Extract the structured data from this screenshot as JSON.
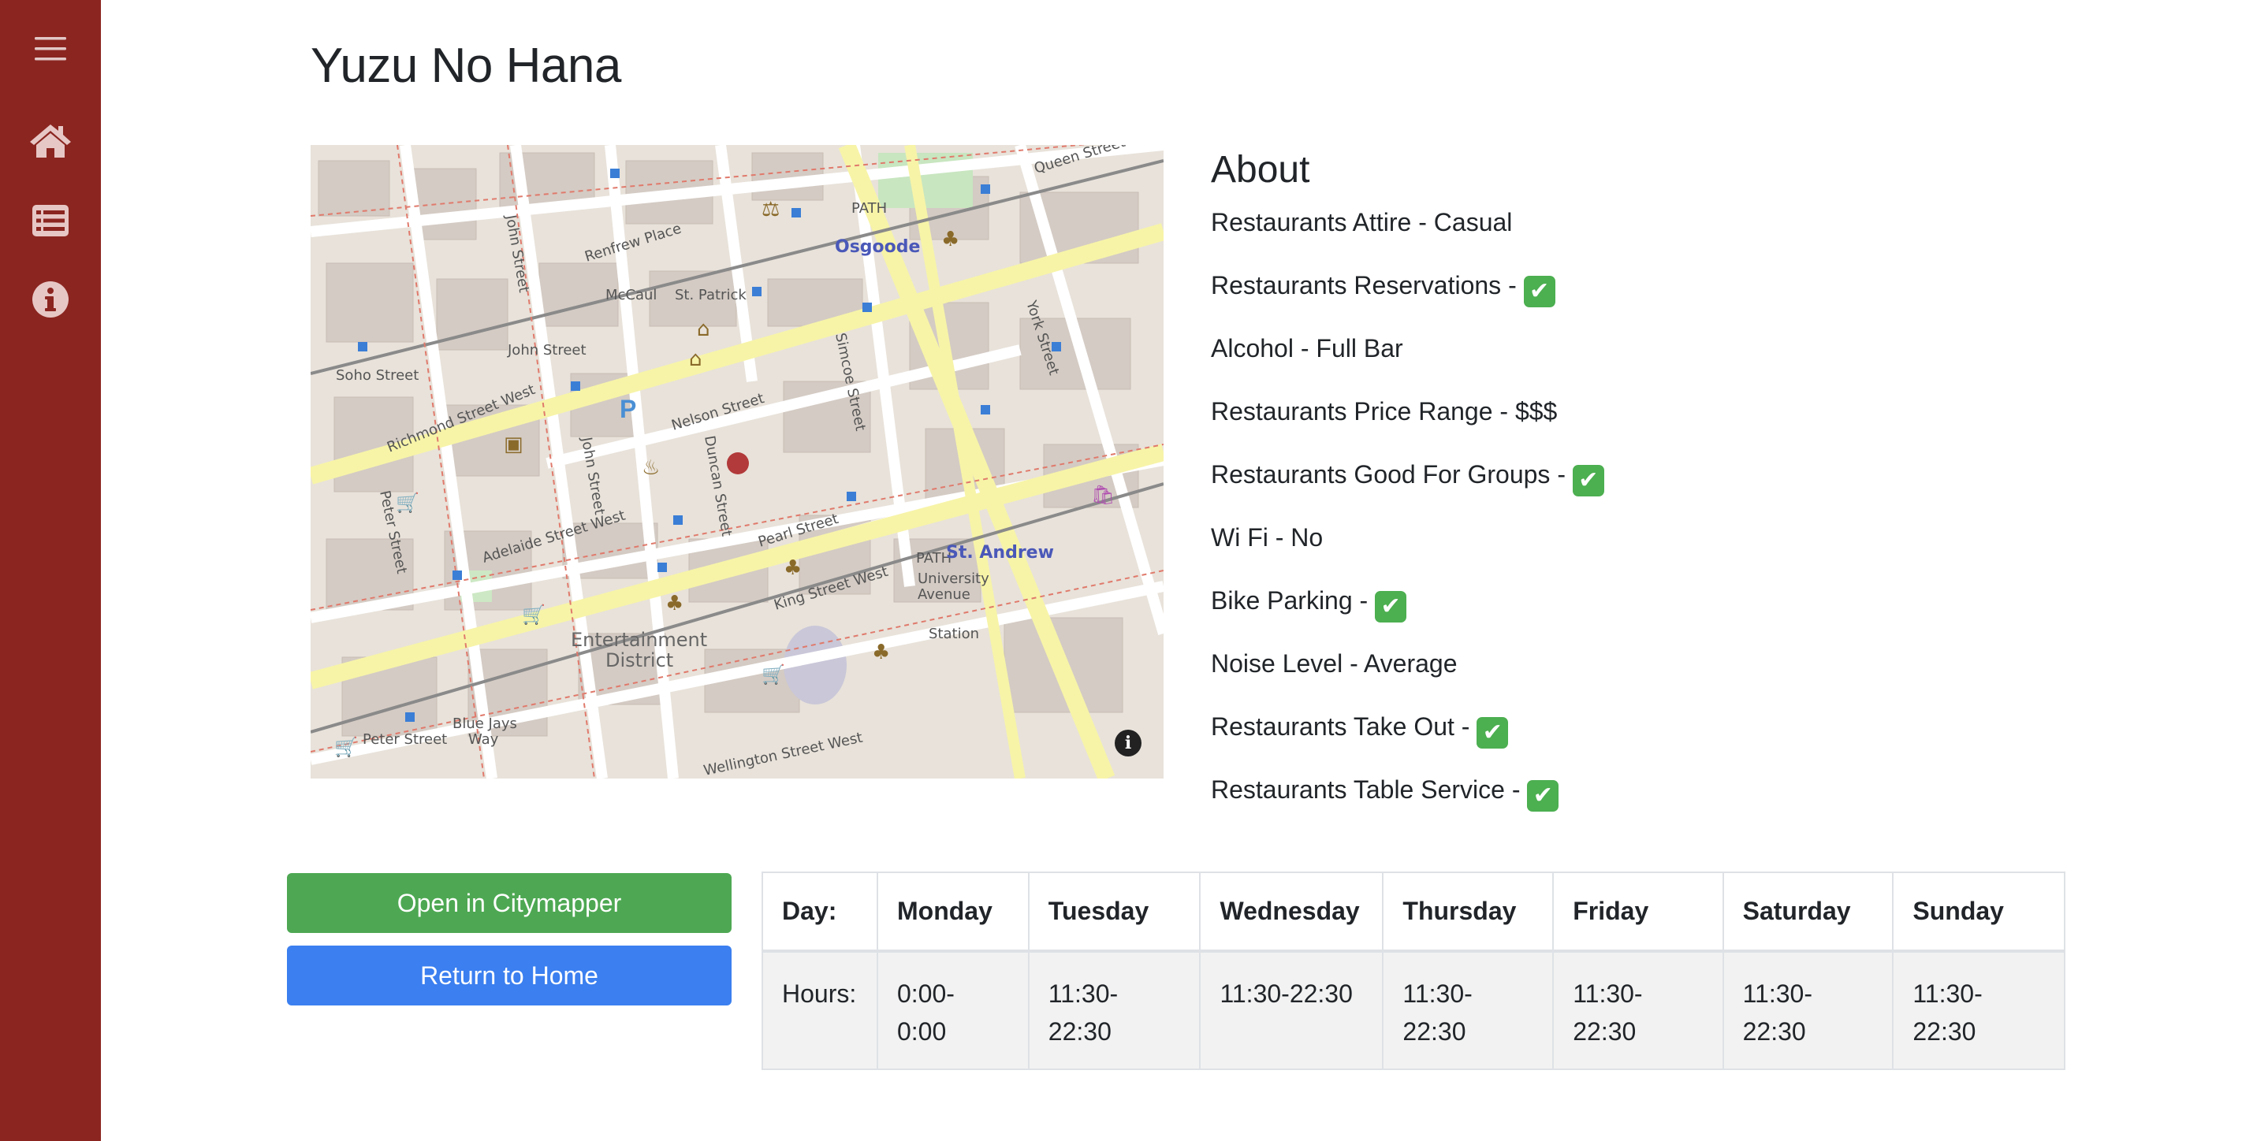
{
  "sidebar": {
    "items": [
      {
        "icon": "menu-icon"
      },
      {
        "icon": "home-icon"
      },
      {
        "icon": "list-icon"
      },
      {
        "icon": "info-icon"
      }
    ],
    "bg_color": "#8b2520"
  },
  "page": {
    "title": "Yuzu No Hana"
  },
  "about": {
    "title": "About",
    "items": [
      {
        "text": "Restaurants Attire - Casual",
        "check": false
      },
      {
        "text": "Restaurants Reservations - ",
        "check": true
      },
      {
        "text": "Alcohol - Full Bar",
        "check": false
      },
      {
        "text": "Restaurants Price Range - $$$",
        "check": false
      },
      {
        "text": "Restaurants Good For Groups - ",
        "check": true
      },
      {
        "text": "Wi Fi - No",
        "check": false
      },
      {
        "text": "Bike Parking - ",
        "check": true
      },
      {
        "text": "Noise Level - Average",
        "check": false
      },
      {
        "text": "Restaurants Take Out - ",
        "check": true
      },
      {
        "text": "Restaurants Table Service - ",
        "check": true
      }
    ],
    "check_glyph": "✔"
  },
  "map": {
    "labels": {
      "osgoode": "Osgoode",
      "st_andrew": "St. Andrew",
      "richmond": "Richmond Street West",
      "adelaide": "Adelaide Street West",
      "king": "King Street West",
      "wellington": "Wellington Street West",
      "john": "John Street",
      "peter": "Peter Street",
      "duncan": "Duncan Street",
      "nelson": "Nelson Street",
      "pearl": "Pearl Street",
      "simcoe": "Simcoe Street",
      "york": "York Street",
      "queen": "Queen Street",
      "renfrew": "Renfrew Place",
      "entertainment": "Entertainment",
      "district": "District",
      "blue_jays": "Blue Jays",
      "way": "Way",
      "soho": "Soho Street",
      "mccaul": "McCaul",
      "st_patrick": "St. Patrick",
      "path": "PATH",
      "university": "University",
      "avenue": "Avenue",
      "station": "Station"
    },
    "info_glyph": "i"
  },
  "actions": {
    "citymapper_label": "Open in Citymapper",
    "home_label": "Return to Home",
    "green": "#4ea853",
    "blue": "#3b7ff0"
  },
  "hours": {
    "headers": [
      "Day:",
      "Monday",
      "Tuesday",
      "Wednesday",
      "Thursday",
      "Friday",
      "Saturday",
      "Sunday"
    ],
    "row_label": "Hours:",
    "values": [
      [
        "0:00-",
        "0:00"
      ],
      [
        "11:30-",
        "22:30"
      ],
      [
        "11:30-22:30",
        ""
      ],
      [
        "11:30-",
        "22:30"
      ],
      [
        "11:30-",
        "22:30"
      ],
      [
        "11:30-",
        "22:30"
      ],
      [
        "11:30-",
        "22:30"
      ]
    ]
  }
}
